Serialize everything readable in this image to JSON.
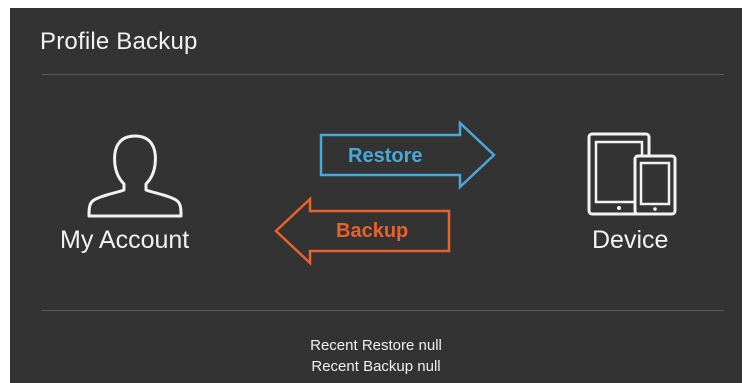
{
  "header": {
    "title": "Profile Backup"
  },
  "account": {
    "label": "My Account",
    "icon": "user-icon"
  },
  "device": {
    "label": "Device",
    "icon": "devices-icon"
  },
  "actions": {
    "restore_label": "Restore",
    "backup_label": "Backup",
    "restore_color": "#4aa8d6",
    "backup_color": "#e8622a"
  },
  "status": {
    "recent_restore": "Recent Restore null",
    "recent_backup": "Recent Backup null"
  }
}
